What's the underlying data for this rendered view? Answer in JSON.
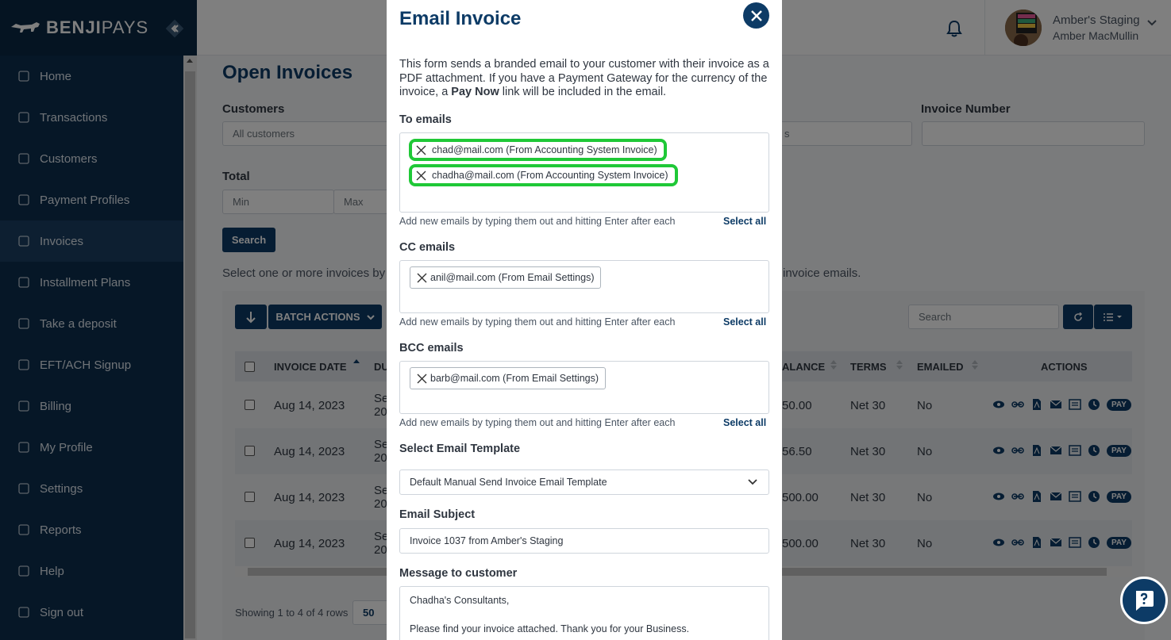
{
  "brand": {
    "name_bold": "BENJI",
    "name_rest": "PAYS"
  },
  "sidebar": {
    "items": [
      {
        "label": "Home",
        "icon": "home-icon"
      },
      {
        "label": "Transactions",
        "icon": "transactions-icon"
      },
      {
        "label": "Customers",
        "icon": "customers-icon"
      },
      {
        "label": "Payment Profiles",
        "icon": "payment-profiles-icon"
      },
      {
        "label": "Invoices",
        "icon": "invoices-icon"
      },
      {
        "label": "Installment Plans",
        "icon": "installment-plans-icon"
      },
      {
        "label": "Take a deposit",
        "icon": "deposit-icon"
      },
      {
        "label": "EFT/ACH Signup",
        "icon": "bank-icon"
      },
      {
        "label": "Billing",
        "icon": "billing-icon"
      },
      {
        "label": "My Profile",
        "icon": "profile-icon"
      },
      {
        "label": "Settings",
        "icon": "gear-icon"
      },
      {
        "label": "Reports",
        "icon": "reports-icon"
      },
      {
        "label": "Help",
        "icon": "help-icon"
      },
      {
        "label": "Sign out",
        "icon": "sign-out-icon"
      }
    ],
    "active": "Invoices"
  },
  "topbar": {
    "org": "Amber's Staging",
    "user": "Amber MacMullin"
  },
  "page": {
    "title": "Open Invoices",
    "customers_label": "Customers",
    "customers_placeholder": "All customers",
    "invoice_number_label": "Invoice Number",
    "hidden_field_fragment": "s",
    "total_label": "Total",
    "min_placeholder": "Min",
    "max_placeholder": "Max",
    "search_button": "Search",
    "hint_left": "Select one or more invoices by",
    "hint_right": "invoice emails.",
    "batch_actions": "BATCH ACTIONS",
    "table_search_placeholder": "Search",
    "columns": {
      "invoice_date": "INVOICE DATE",
      "due_fragment": "DU",
      "balance_fragment": "ALANCE",
      "terms": "TERMS",
      "emailed": "EMAILED",
      "actions": "ACTIONS"
    },
    "rows": [
      {
        "date": "Aug 14, 2023",
        "due1": "Se",
        "due2": "20",
        "balance": "50.00",
        "terms": "Net 30",
        "emailed": "No"
      },
      {
        "date": "Aug 14, 2023",
        "due1": "Se",
        "due2": "20",
        "balance": "56.50",
        "terms": "Net 30",
        "emailed": "No"
      },
      {
        "date": "Aug 14, 2023",
        "due1": "Se",
        "due2": "20",
        "balance": "500.00",
        "terms": "Net 30",
        "emailed": "No"
      },
      {
        "date": "Aug 14, 2023",
        "due1": "Se",
        "due2": "20",
        "balance": "500.00",
        "terms": "Net 30",
        "emailed": "No"
      }
    ],
    "pay_label": "PAY",
    "footer": "Showing 1 to 4 of 4 rows",
    "page_size": "50"
  },
  "modal": {
    "title": "Email Invoice",
    "desc_1": "This form sends a branded email to your customer with their invoice as a PDF attachment. If you have a Payment Gateway for the currency of the invoice, a ",
    "desc_bold": "Pay Now",
    "desc_2": " link will be included in the email.",
    "to_label": "To emails",
    "to_tags": [
      "chad@mail.com (From Accounting System Invoice)",
      "chadha@mail.com (From Accounting System Invoice)"
    ],
    "cc_label": "CC emails",
    "cc_tags": [
      "anil@mail.com (From Email Settings)"
    ],
    "bcc_label": "BCC emails",
    "bcc_tags": [
      "barb@mail.com (From Email Settings)"
    ],
    "help_text": "Add new emails by typing them out and hitting Enter after each",
    "select_all": "Select all",
    "template_label": "Select Email Template",
    "template_value": "Default Manual Send Invoice Email Template",
    "subject_label": "Email Subject",
    "subject_value": "Invoice 1037 from Amber's Staging",
    "message_label": "Message to customer",
    "message_value": "Chadha's Consultants,\n\nPlease find your invoice attached.  Thank you for your Business."
  },
  "colors": {
    "primary": "#0d3b66",
    "sidebar": "#0d2f4f",
    "highlight": "#1fc837"
  }
}
